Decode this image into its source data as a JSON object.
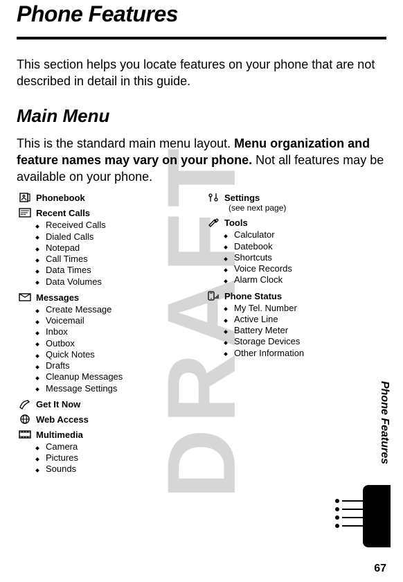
{
  "watermark": "DRAFT",
  "title": "Phone Features",
  "intro": "This section helps you locate features on your phone that are not described in detail in this guide.",
  "mainmenu_heading": "Main Menu",
  "menudesc_part1": "This is the standard main menu layout. ",
  "menudesc_bold": "Menu organization and feature names may vary on your phone.",
  "menudesc_part2": " Not all features may be available on your phone.",
  "side_tab_label": "Phone Features",
  "page_number": "67",
  "left_sections": [
    {
      "icon": "phonebook-icon",
      "label": "Phonebook",
      "items": []
    },
    {
      "icon": "recent-calls-icon",
      "label": "Recent Calls",
      "items": [
        "Received Calls",
        "Dialed Calls",
        "Notepad",
        "Call Times",
        "Data Times",
        "Data Volumes"
      ]
    },
    {
      "icon": "messages-icon",
      "label": "Messages",
      "items": [
        "Create Message",
        "Voicemail",
        "Inbox",
        "Outbox",
        "Quick Notes",
        "Drafts",
        "Cleanup Messages",
        "Message Settings"
      ]
    },
    {
      "icon": "get-it-now-icon",
      "label": "Get It Now",
      "items": []
    },
    {
      "icon": "web-access-icon",
      "label": "Web Access",
      "items": []
    },
    {
      "icon": "multimedia-icon",
      "label": "Multimedia",
      "items": [
        "Camera",
        "Pictures",
        "Sounds"
      ]
    }
  ],
  "right_sections": [
    {
      "icon": "settings-icon",
      "label": "Settings",
      "subnote": "(see next page)",
      "items": []
    },
    {
      "icon": "tools-icon",
      "label": "Tools",
      "items": [
        "Calculator",
        "Datebook",
        "Shortcuts",
        "Voice Records",
        "Alarm Clock"
      ]
    },
    {
      "icon": "phone-status-icon",
      "label": "Phone Status",
      "items": [
        "My Tel. Number",
        "Active Line",
        "Battery Meter",
        "Storage Devices",
        "Other Information"
      ]
    }
  ]
}
